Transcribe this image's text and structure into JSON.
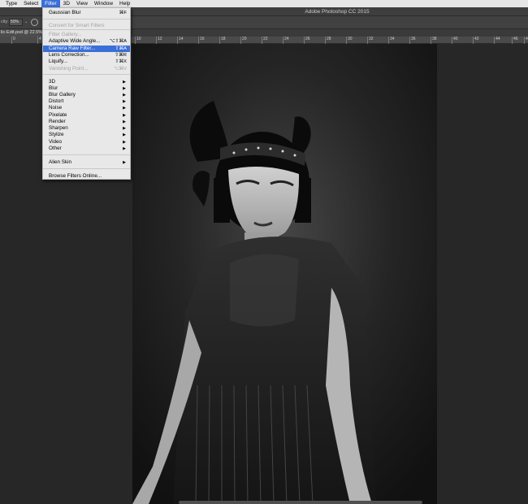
{
  "menubar": {
    "items": [
      {
        "label": "Type"
      },
      {
        "label": "Select"
      },
      {
        "label": "Filter"
      },
      {
        "label": "3D"
      },
      {
        "label": "View"
      },
      {
        "label": "Window"
      },
      {
        "label": "Help"
      }
    ],
    "active": "Filter",
    "highlight_color": "#3a6fd8"
  },
  "titlebar": {
    "title": "Adobe Photoshop CC 2015"
  },
  "options": {
    "label": "city:",
    "value": "50%",
    "chevron": "⌄"
  },
  "document": {
    "tab_label": "lic-Edit.psd @ 22.5%"
  },
  "ruler": {
    "ticks": [
      "0",
      "4",
      "2",
      "4",
      "6",
      "8",
      "10",
      "12",
      "14",
      "16",
      "18",
      "20",
      "22",
      "24",
      "26",
      "28",
      "30",
      "32",
      "34",
      "36",
      "38",
      "40",
      "42",
      "44",
      "46",
      "48"
    ]
  },
  "filter_menu": {
    "items": [
      {
        "label": "Gaussian Blur",
        "shortcut": "⌘F",
        "disabled": false
      },
      {
        "label": "Convert for Smart Filters",
        "shortcut": "",
        "disabled": true
      },
      {
        "label": "Filter Gallery...",
        "shortcut": "",
        "disabled": true
      },
      {
        "label": "Adaptive Wide Angle...",
        "shortcut": "⌥⇧⌘A",
        "disabled": false
      },
      {
        "label": "Camera Raw Filter...",
        "shortcut": "⇧⌘A",
        "disabled": false,
        "highlighted": true
      },
      {
        "label": "Lens Correction...",
        "shortcut": "⇧⌘R",
        "disabled": false
      },
      {
        "label": "Liquify...",
        "shortcut": "⇧⌘X",
        "disabled": false
      },
      {
        "label": "Vanishing Point...",
        "shortcut": "⌥⌘V",
        "disabled": true
      },
      {
        "label": "3D",
        "submenu": true
      },
      {
        "label": "Blur",
        "submenu": true
      },
      {
        "label": "Blur Gallery",
        "submenu": true
      },
      {
        "label": "Distort",
        "submenu": true
      },
      {
        "label": "Noise",
        "submenu": true
      },
      {
        "label": "Pixelate",
        "submenu": true
      },
      {
        "label": "Render",
        "submenu": true
      },
      {
        "label": "Sharpen",
        "submenu": true
      },
      {
        "label": "Stylize",
        "submenu": true
      },
      {
        "label": "Video",
        "submenu": true
      },
      {
        "label": "Other",
        "submenu": true
      },
      {
        "label": "Alien Skin",
        "submenu": true
      },
      {
        "label": "Browse Filters Online...",
        "submenu": false
      }
    ],
    "submenu_arrow": "▶"
  },
  "colors": {
    "canvas_bg": "#272727",
    "menu_bg": "#e8e8e8",
    "ui_dark": "#414141"
  }
}
